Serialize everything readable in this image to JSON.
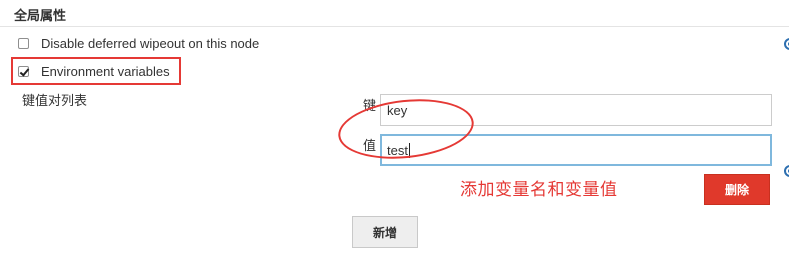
{
  "section": {
    "title": "全局属性"
  },
  "options": {
    "disable_wipeout": {
      "label": "Disable deferred wipeout on this node",
      "checked": false
    },
    "env_vars": {
      "label": "Environment variables",
      "checked": true
    }
  },
  "env": {
    "list_label": "键值对列表",
    "key_label": "键",
    "value_label": "值",
    "key_value": "key",
    "value_value": "test",
    "delete_label": "删除",
    "add_label": "新增"
  },
  "annotation": {
    "text": "添加变量名和变量值"
  },
  "colors": {
    "annotation_red": "#e53935",
    "delete_button": "#e0392b",
    "focus_border": "#7fb8dd",
    "help_blue": "#2d6fb0"
  },
  "icons": {
    "help": "help-icon"
  }
}
